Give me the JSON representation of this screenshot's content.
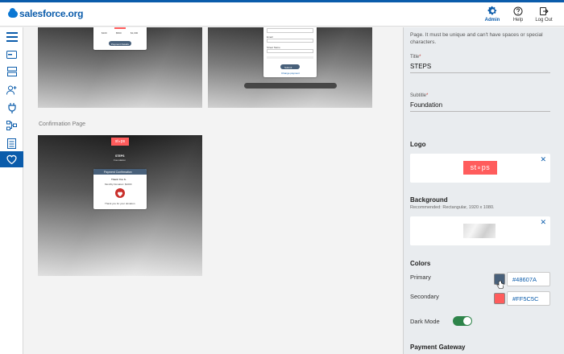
{
  "header": {
    "logo_text": "salesforce.org",
    "buttons": [
      {
        "label": "Admin",
        "icon": "gear-icon",
        "active": true
      },
      {
        "label": "Help",
        "icon": "question-icon"
      },
      {
        "label": "Log Out",
        "icon": "logout-icon"
      }
    ]
  },
  "leftnav": {
    "icons": [
      "menu-icon",
      "card-icon",
      "server-icon",
      "user-add-icon",
      "plug-icon",
      "workflow-icon",
      "report-icon",
      "heart-icon"
    ],
    "active_index": 7
  },
  "main": {
    "preview1": {
      "amounts": [
        "$100",
        "$500",
        "$1,000"
      ],
      "button": "Payment Details"
    },
    "preview2": {
      "fields": [
        "Email",
        "Street Name"
      ],
      "button": "Submit",
      "link": "Change payment"
    },
    "confirmation_label": "Confirmation Page",
    "confirmation": {
      "logo": "st∘ps",
      "title": "STEPS",
      "subtitle": "Foundation",
      "card_header": "Payment Confirmation",
      "thank_you": "Thank You S.",
      "donation": "Monthly Donation: $1000",
      "footer": "Thank you for your donation."
    }
  },
  "panel": {
    "intro_text": "Page. It must be unique and can't have spaces or special characters.",
    "title_label": "Title",
    "title_value": "STEPS",
    "subtitle_label": "Subtitle",
    "subtitle_value": "Foundation",
    "logo_heading": "Logo",
    "logo_text": "st∘ps",
    "background_heading": "Background",
    "background_hint": "Recommended: Rectangular, 1920 x 1080.",
    "colors_heading": "Colors",
    "primary_label": "Primary",
    "primary_value": "#48607A",
    "secondary_label": "Secondary",
    "secondary_value": "#FF5C5C",
    "dark_mode_label": "Dark Mode",
    "dark_mode_on": true,
    "payment_gateway_heading": "Payment Gateway",
    "close_glyph": "✕"
  },
  "colors": {
    "brand": "#0b5cab",
    "primary": "#48607A",
    "secondary": "#FF5C5C",
    "toggle_on": "#2e844a"
  }
}
